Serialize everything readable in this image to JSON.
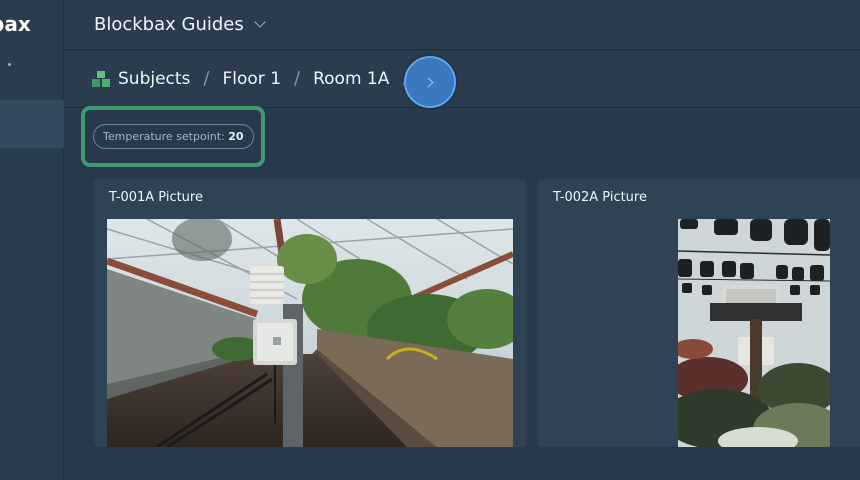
{
  "app": {
    "logo_text": "bax"
  },
  "header": {
    "workspace_name": "Blockbax Guides"
  },
  "breadcrumb": {
    "items": [
      "Subjects",
      "Floor 1",
      "Room 1A"
    ],
    "separator": "/"
  },
  "property": {
    "label": "Temperature setpoint:",
    "value": "20"
  },
  "cards": [
    {
      "title": "T-001A Picture"
    },
    {
      "title": "T-002A Picture"
    }
  ],
  "colors": {
    "background": "#27394a",
    "header": "#2a3c4e",
    "card": "#2f4355",
    "highlight": "#3f9a71",
    "accent_button": "#3a78c0",
    "cube_icon": "#4caf6e"
  }
}
